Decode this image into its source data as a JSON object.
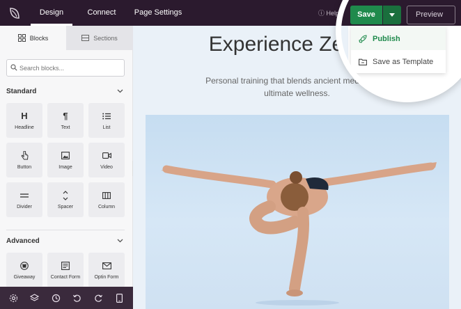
{
  "topbar": {
    "tabs": [
      "Design",
      "Connect",
      "Page Settings"
    ],
    "help_label": "Help",
    "save_label": "Save",
    "preview_label": "Preview",
    "menu": {
      "publish_label": "Publish",
      "template_label": "Save as Template"
    }
  },
  "sidebar": {
    "tabs": [
      "Blocks",
      "Sections"
    ],
    "search_placeholder": "Search blocks...",
    "standard_heading": "Standard",
    "standard_blocks": [
      "Headline",
      "Text",
      "List",
      "Button",
      "Image",
      "Video",
      "Divider",
      "Spacer",
      "Column"
    ],
    "advanced_heading": "Advanced",
    "advanced_blocks": [
      "Giveaway",
      "Contact Form",
      "Optin Form"
    ]
  },
  "canvas": {
    "headline": "Experience Ze",
    "subtext_line1": "Personal training that blends ancient meditation a",
    "subtext_line2": "ultimate wellness."
  },
  "colors": {
    "topbar": "#2b1a2e",
    "save_green": "#1f8a4c",
    "canvas_bg": "#eaf1f8"
  },
  "icons": [
    "seedprod-logo-icon",
    "help-icon",
    "caret-down-icon",
    "close-icon",
    "blocks-icon",
    "sections-icon",
    "search-icon",
    "chevron-down-icon",
    "rocket-icon",
    "template-icon",
    "settings-icon",
    "layers-icon",
    "history-icon",
    "undo-icon",
    "redo-icon",
    "mobile-icon"
  ]
}
